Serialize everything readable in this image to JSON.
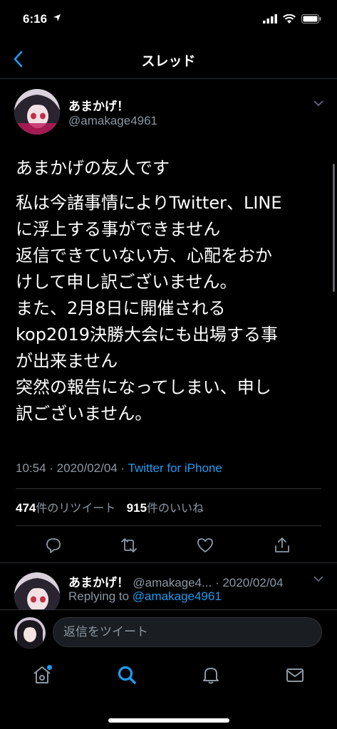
{
  "status": {
    "time": "6:16"
  },
  "nav": {
    "title": "スレッド"
  },
  "tweet": {
    "name": "あまかげ！",
    "handle": "@amakage4961",
    "lines": [
      "あまかげの友人です",
      "私は今諸事情によりTwitter、LINE",
      "に浮上する事ができません",
      "返信できていない方、心配をおか",
      "けして申し訳ございません。",
      "また、2月8日に開催される",
      "kop2019決勝大会にも出場する事",
      "が出来ません",
      "突然の報告になってしまい、申し",
      "訳ございません。"
    ],
    "time": "10:54",
    "date": "2020/02/04",
    "sep": " · ",
    "source": "Twitter for iPhone",
    "retweets": "474",
    "retweets_label": "件のリツイート",
    "likes": "915",
    "likes_label": "件のいいね"
  },
  "reply": {
    "name": "あまかげ！",
    "handle_date": "@amakage4... · 2020/02/04",
    "replying_prefix": "Replying to ",
    "replying_to": "@amakage4961"
  },
  "composer": {
    "placeholder": "返信をツイート"
  },
  "colors": {
    "accent": "#1d9bf0",
    "muted": "#8b98a5",
    "background": "#000000"
  },
  "icons": {
    "back": "chevron-left-icon",
    "reply": "comment-icon",
    "retweet": "retweet-icon",
    "like": "heart-icon",
    "share": "share-icon",
    "home": "home-icon",
    "search": "search-icon",
    "notifications": "bell-icon",
    "messages": "mail-icon"
  }
}
